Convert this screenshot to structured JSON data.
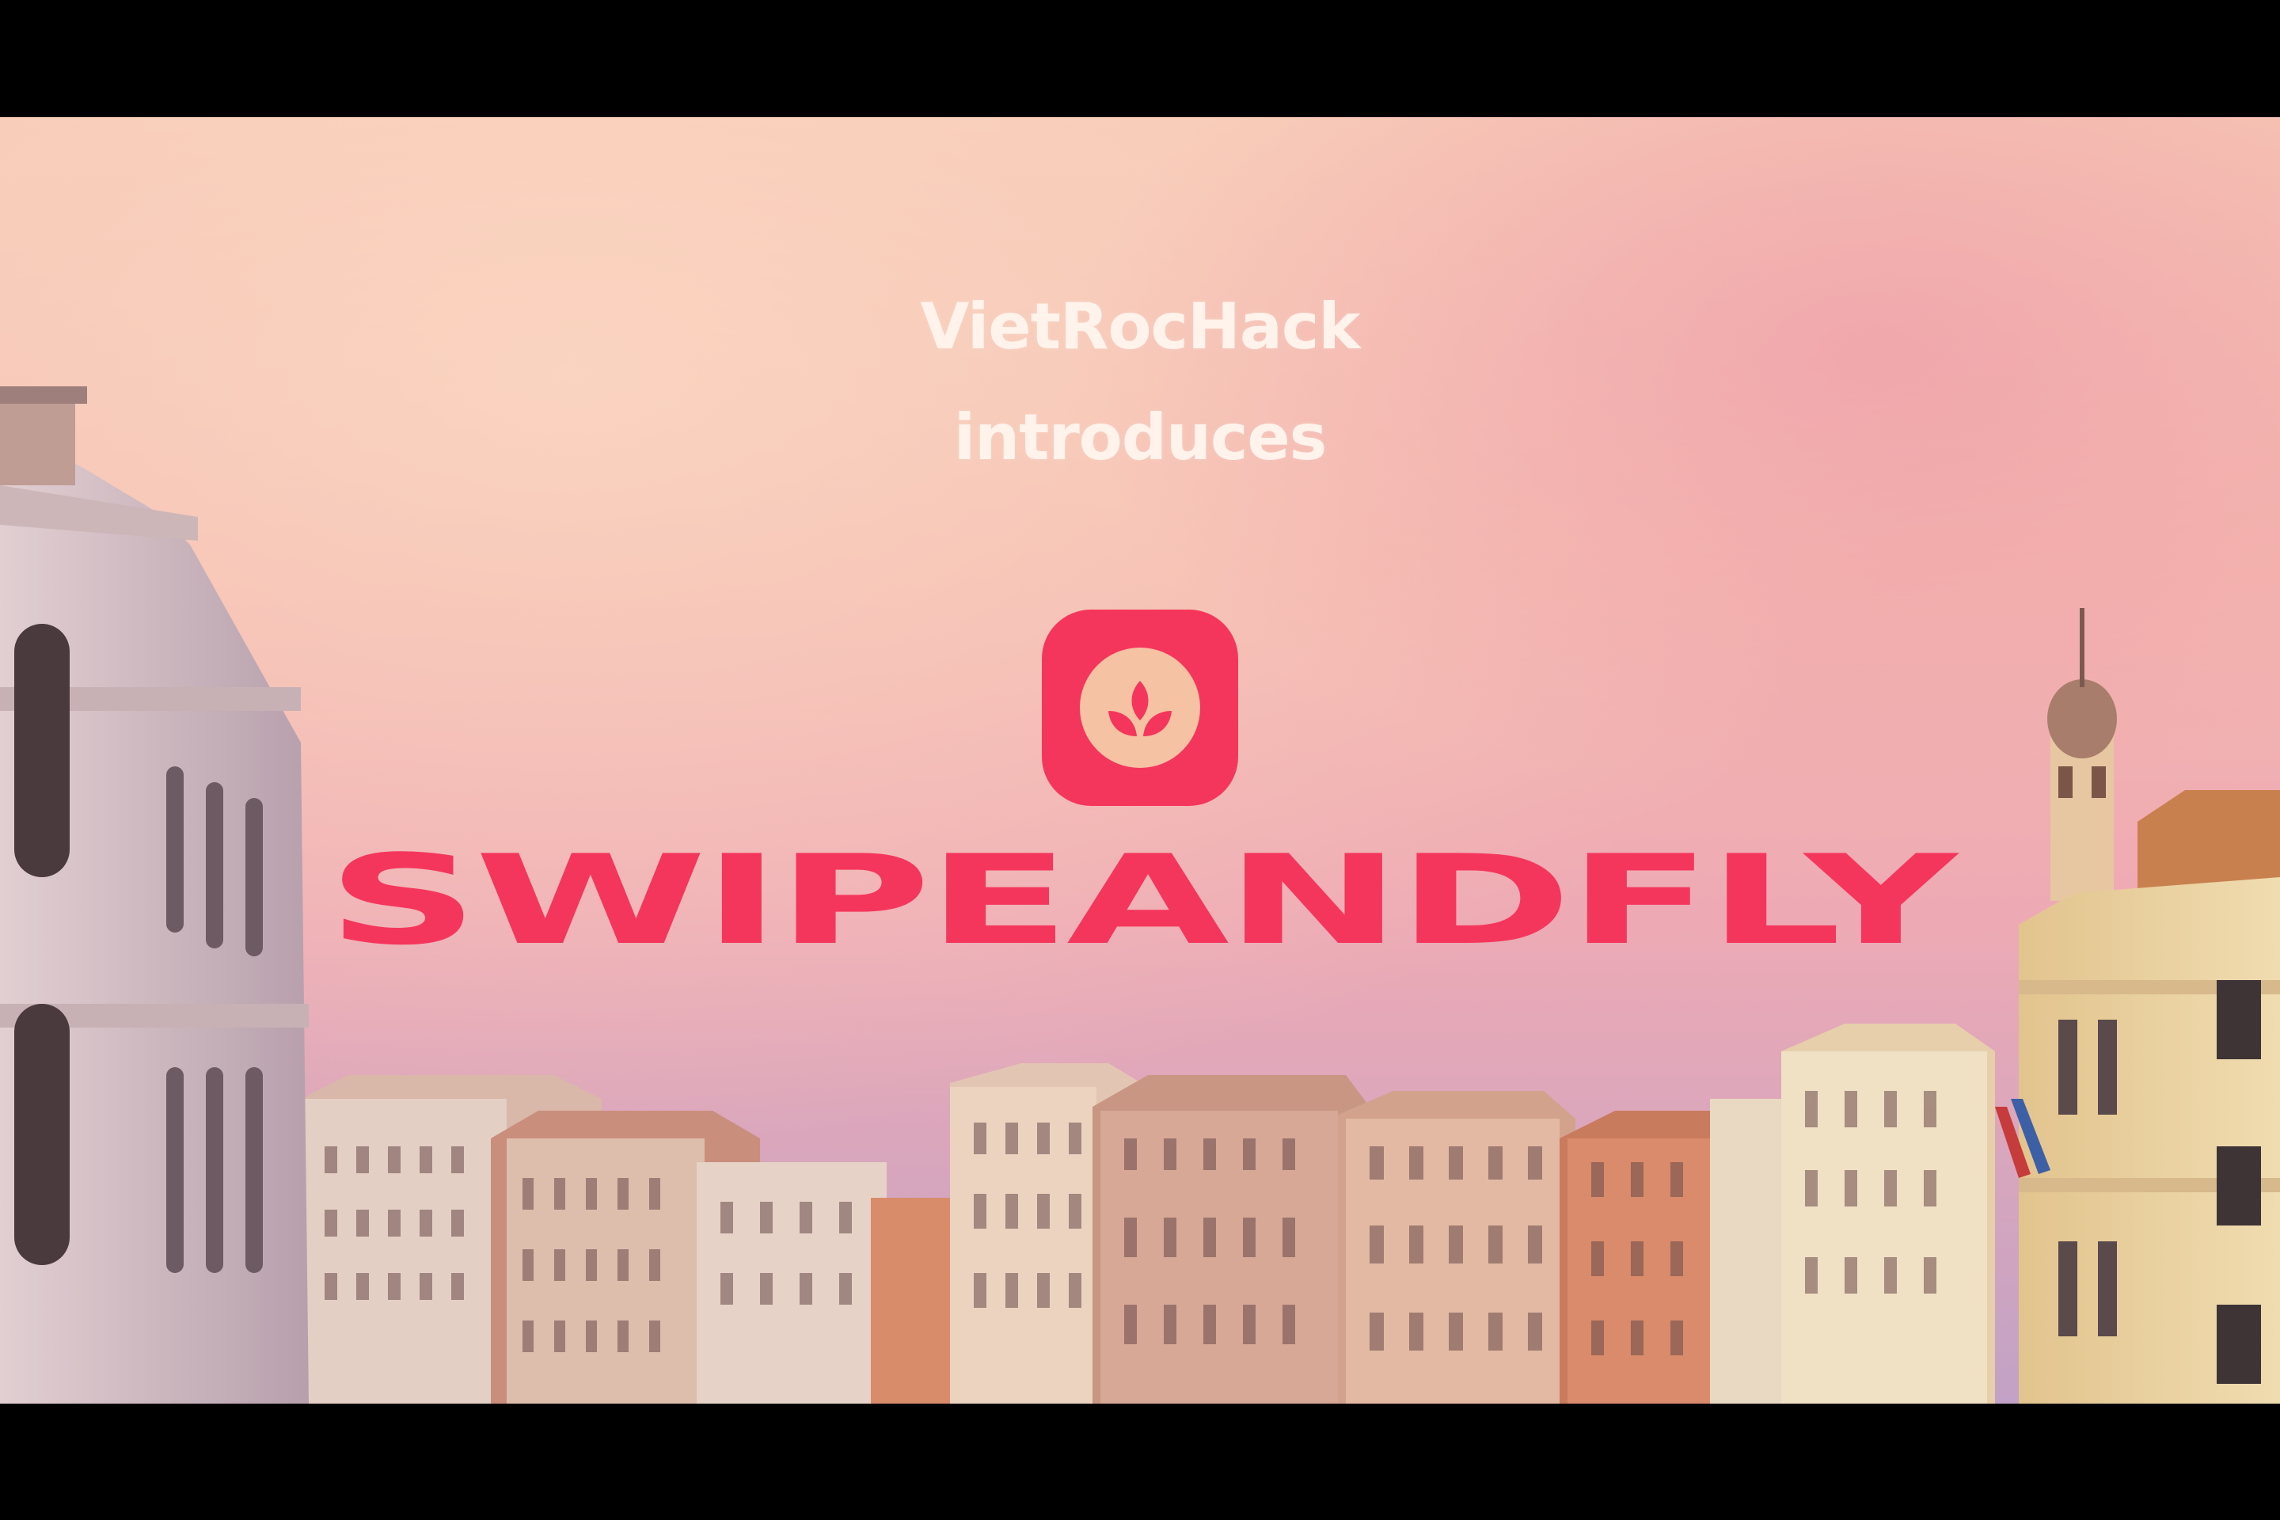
{
  "intro": {
    "line1": "VietRocHack",
    "line2": "introduces"
  },
  "brand": {
    "name": "SWIPEANDFLY",
    "icon": "leaf-sprout-icon"
  },
  "colors": {
    "brand_red": "#f5365c",
    "icon_disc": "#f6c2a4",
    "intro_text": "#fff3ec",
    "sky_top": "#f7c8b4",
    "sky_mid": "#f2aeb0",
    "sky_bottom": "#c9a4c8"
  }
}
